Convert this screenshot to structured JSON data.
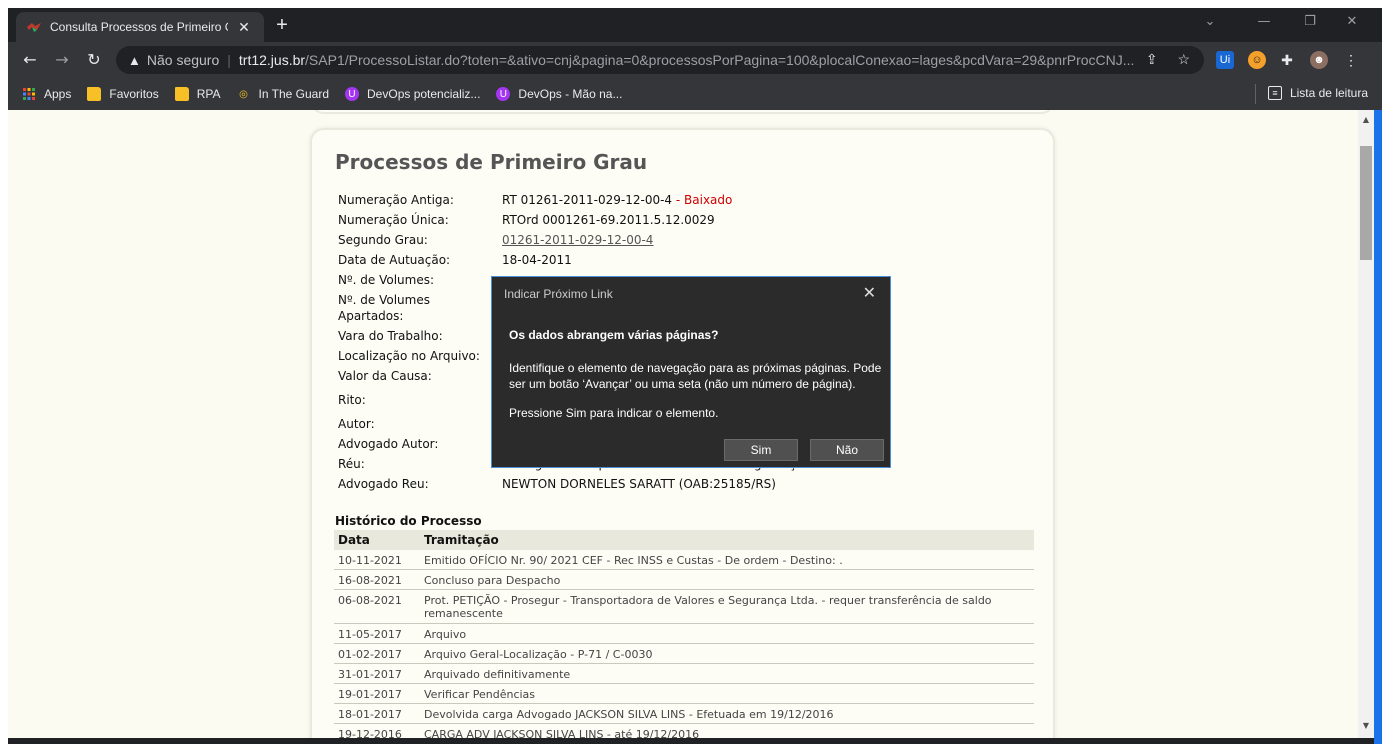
{
  "browser": {
    "tab_title": "Consulta Processos de Primeiro G",
    "tab_close": "✕",
    "new_tab": "+",
    "address": {
      "security_label": "Não seguro",
      "host": "trt12.jus.br",
      "path": "/SAP1/ProcessoListar.do?toten=&ativo=cnj&pagina=0&processosPorPagina=100&plocalConexao=lages&pcdVara=29&pnrProcCNJ..."
    },
    "bookmarks": [
      {
        "label": "Apps",
        "icon": "apps-grid-icon"
      },
      {
        "label": "Favoritos",
        "icon": "folder-icon"
      },
      {
        "label": "RPA",
        "icon": "folder-icon"
      },
      {
        "label": "In The Guard",
        "icon": "ring-icon"
      },
      {
        "label": "DevOps potencializ...",
        "icon": "udemy-icon"
      },
      {
        "label": "DevOps - Mão na...",
        "icon": "udemy-icon"
      }
    ],
    "reading_list": "Lista de leitura"
  },
  "page": {
    "title": "Processos de Primeiro Grau",
    "fields": [
      {
        "label": "Numeração Antiga:",
        "value": "RT 01261-2011-029-12-00-4",
        "suffix": " - Baixado"
      },
      {
        "label": "Numeração Única:",
        "value": "RTOrd 0001261-69.2011.5.12.0029"
      },
      {
        "label": "Segundo Grau:",
        "value": "01261-2011-029-12-00-4"
      },
      {
        "label": "Data de Autuação:",
        "value": "18-04-2011"
      },
      {
        "label": "Nº. de Volumes:",
        "value": ""
      },
      {
        "label": "Nº. de Volumes",
        "label2": "Apartados:",
        "value": ""
      },
      {
        "label": "Vara do Trabalho:",
        "value": ""
      },
      {
        "label": "Localização no Arquivo:",
        "value": ""
      },
      {
        "label": "Valor da Causa:",
        "value": ""
      },
      {
        "label": "Rito:",
        "value": ""
      },
      {
        "label": "Autor:",
        "value": ""
      },
      {
        "label": "Advogado Autor:",
        "value": ""
      },
      {
        "label": "Réu:",
        "value": "Prosegur - Transportadora de Valores e Segurança Ltda."
      },
      {
        "label": "Advogado Reu:",
        "value": "NEWTON DORNELES SARATT (OAB:25185/RS)"
      }
    ],
    "history": {
      "title": "Histórico do Processo",
      "col_date": "Data",
      "col_action": "Tramitação",
      "rows": [
        {
          "date": "10-11-2021",
          "text": "Emitido OFÍCIO Nr. 90/ 2021 CEF - Rec INSS e Custas - De ordem - Destino: ."
        },
        {
          "date": "16-08-2021",
          "text": "Concluso para Despacho"
        },
        {
          "date": "06-08-2021",
          "text": "Prot. PETIÇÃO - Prosegur - Transportadora de Valores e Segurança Ltda. - requer transferência de saldo remanescente"
        },
        {
          "date": "11-05-2017",
          "text": "Arquivo"
        },
        {
          "date": "01-02-2017",
          "text": "Arquivo Geral-Localização - P-71 / C-0030"
        },
        {
          "date": "31-01-2017",
          "text": "Arquivado definitivamente"
        },
        {
          "date": "19-01-2017",
          "text": "Verificar Pendências"
        },
        {
          "date": "18-01-2017",
          "text": "Devolvida carga Advogado JACKSON SILVA LINS - Efetuada em 19/12/2016"
        },
        {
          "date": "19-12-2016",
          "text": "CARGA ADV JACKSON SILVA LINS - até 19/12/2016"
        }
      ]
    }
  },
  "dialog": {
    "title": "Indicar Próximo Link",
    "close": "✕",
    "heading": "Os dados abrangem várias páginas?",
    "body": "Identifique o elemento de navegação para as próximas páginas. Pode ser um botão ‘Avançar’ ou uma seta (não um número de página).",
    "body2": "Pressione Sim para indicar o elemento.",
    "yes_label": "Sim",
    "no_label": "Não"
  }
}
